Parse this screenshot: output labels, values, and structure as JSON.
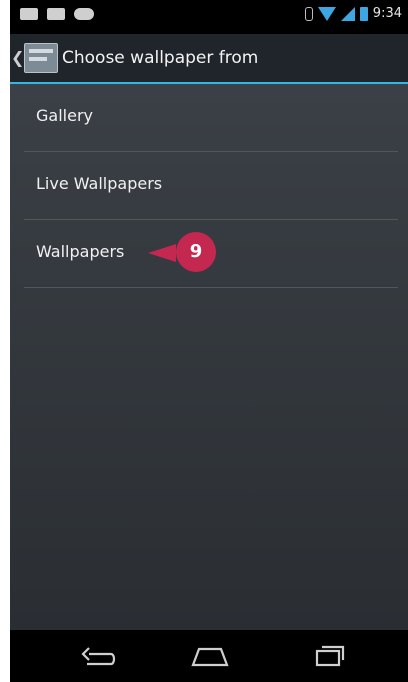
{
  "status_bar": {
    "time": "9:34",
    "icons": [
      "mail-icon",
      "message-icon",
      "gamepad-icon",
      "bluetooth-icon",
      "wifi-icon",
      "signal-icon",
      "battery-icon"
    ]
  },
  "action_bar": {
    "title": "Choose wallpaper from",
    "up_icon": "caret-left-icon",
    "app_icon": "wallpaper-app-icon"
  },
  "menu": {
    "items": [
      {
        "label": "Gallery"
      },
      {
        "label": "Live Wallpapers"
      },
      {
        "label": "Wallpapers"
      }
    ]
  },
  "callout": {
    "step": "9",
    "color": "#c4274f"
  },
  "nav_bar": {
    "buttons": [
      "back-icon",
      "home-icon",
      "recent-apps-icon"
    ]
  },
  "colors": {
    "accent": "#33b5e5",
    "action_bar": "#20252b",
    "content_bg": "#33383d"
  }
}
